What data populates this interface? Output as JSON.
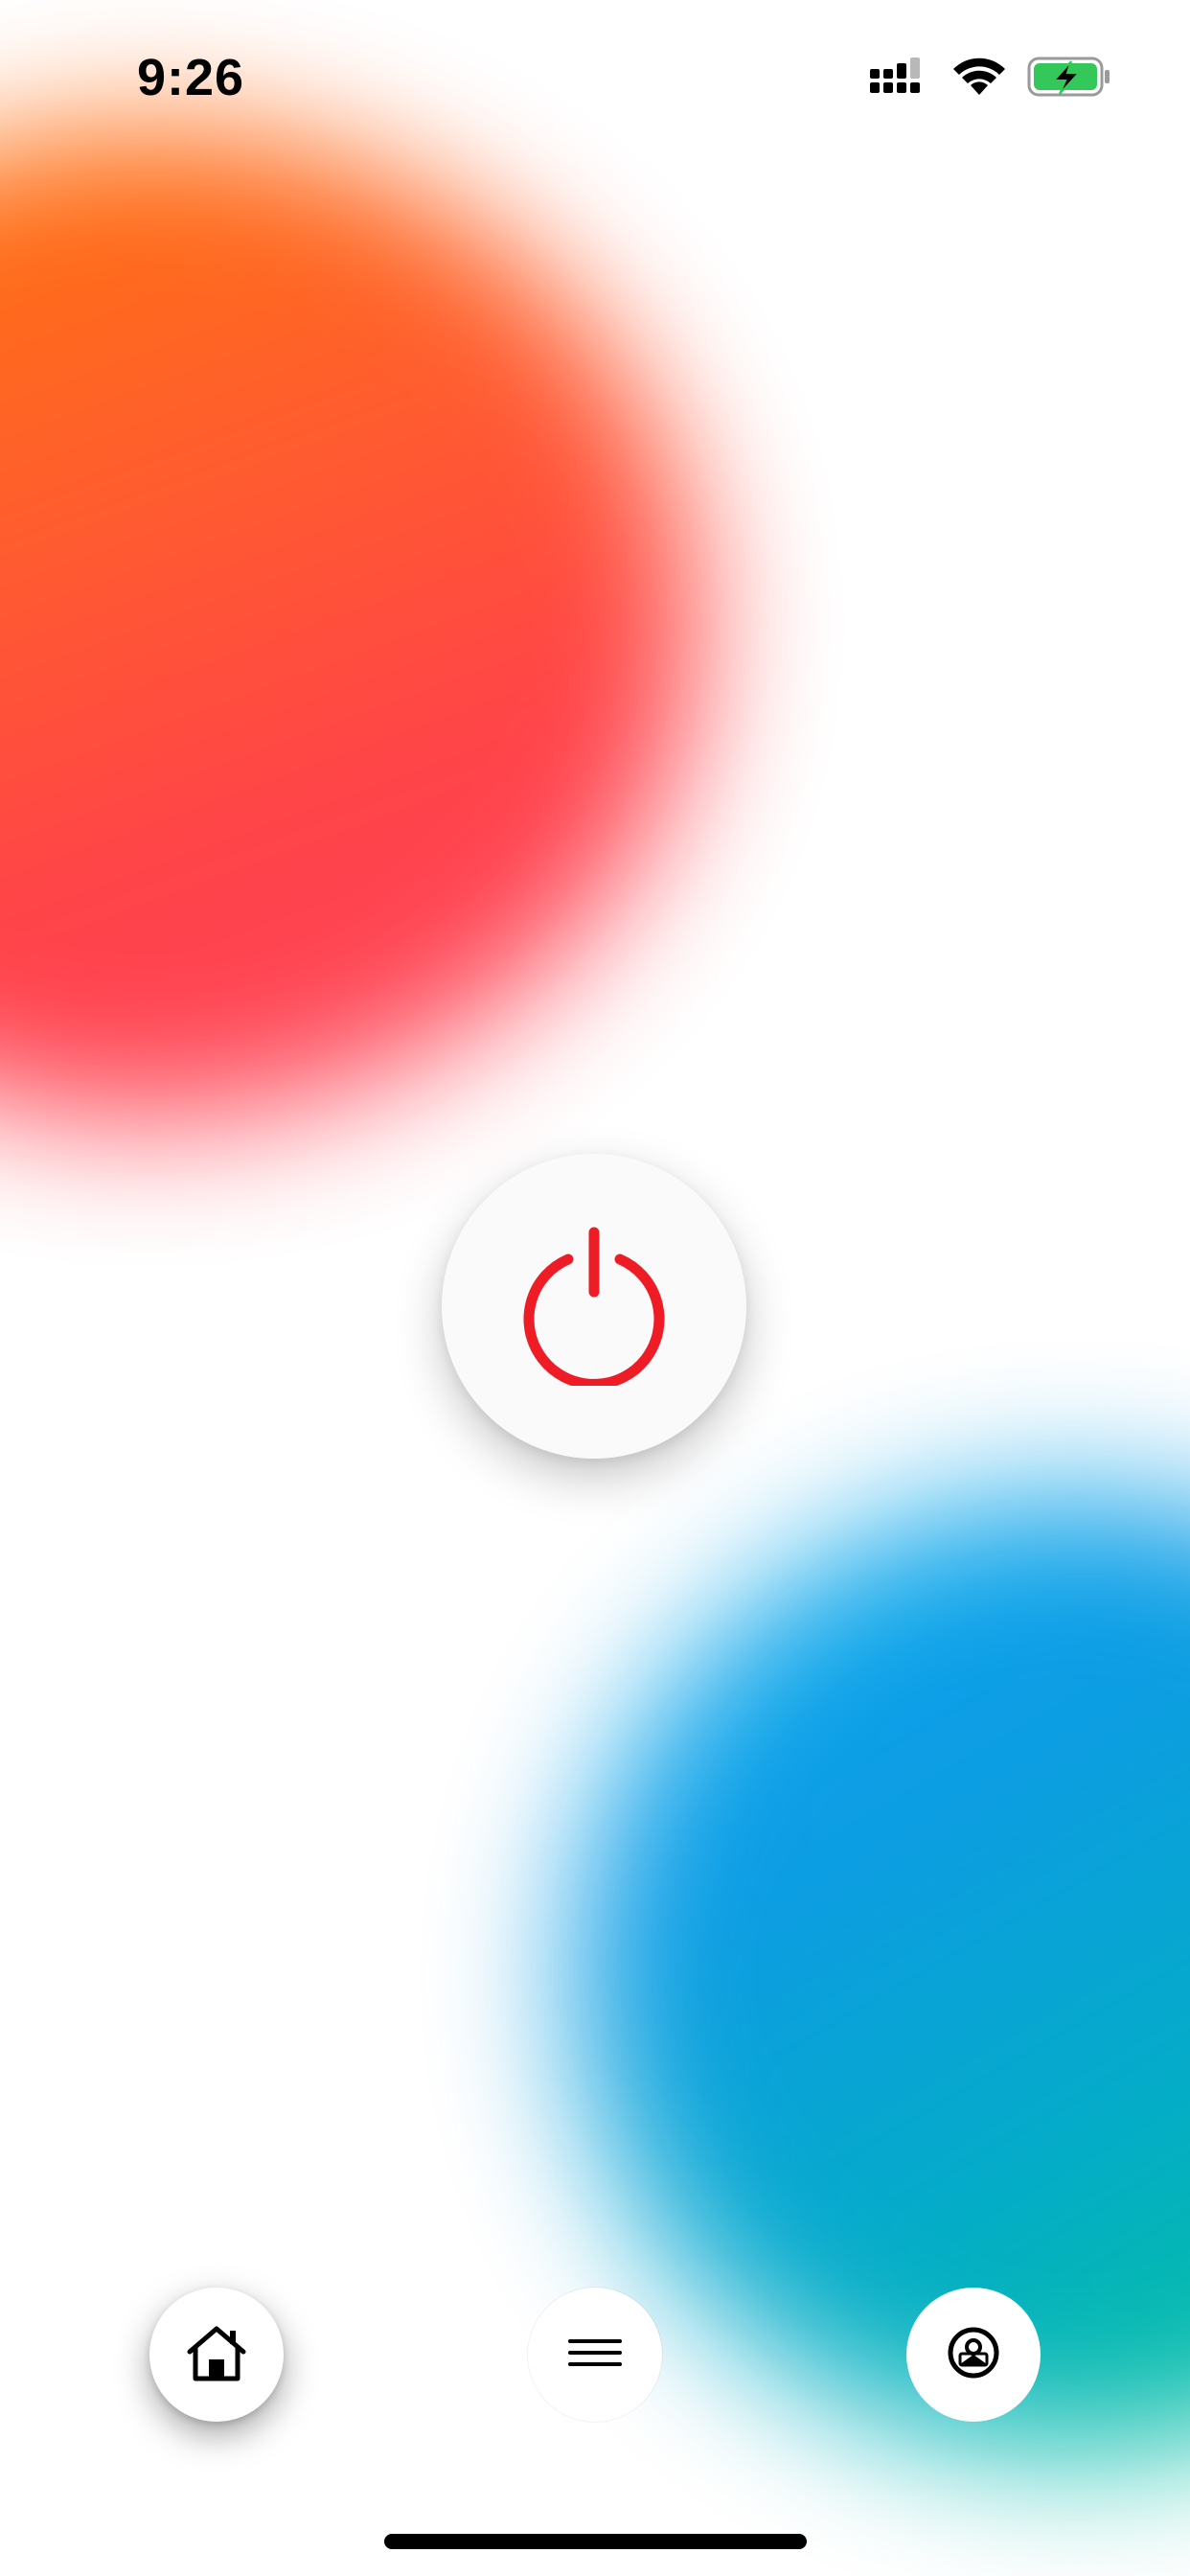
{
  "status_bar": {
    "time": "9:26",
    "icons": [
      "cellular-signal-icon",
      "wifi-icon",
      "battery-charging-icon"
    ],
    "battery_color": "#34c759"
  },
  "power": {
    "icon": "power-icon",
    "color": "#ee1c25"
  },
  "bottom_nav": {
    "items": [
      {
        "icon": "home-icon"
      },
      {
        "icon": "menu-icon"
      },
      {
        "icon": "account-icon"
      }
    ]
  },
  "colors": {
    "orange_blob": "#ff6a10",
    "blue_blob": "#0a9ae6",
    "teal_blob": "#00c0a0"
  }
}
